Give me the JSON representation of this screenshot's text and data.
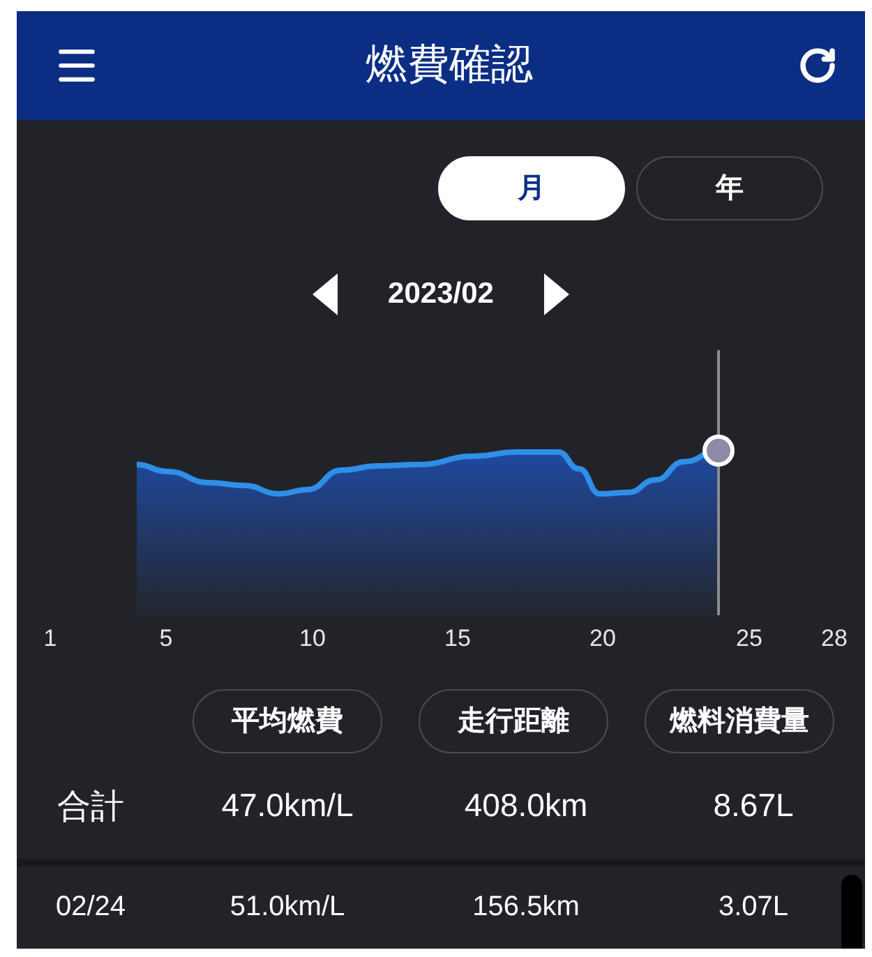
{
  "header": {
    "title": "燃費確認"
  },
  "period_tabs": [
    {
      "label": "月",
      "selected": true
    },
    {
      "label": "年",
      "selected": false
    }
  ],
  "month_nav": {
    "label": "2023/02"
  },
  "chart": {
    "x_labels": [
      "1",
      "5",
      "10",
      "15",
      "20",
      "25",
      "28"
    ]
  },
  "metric_buttons": [
    "平均燃費",
    "走行距離",
    "燃料消費量"
  ],
  "summary_row": {
    "label": "合計",
    "values": [
      "47.0km/L",
      "408.0km",
      "8.67L"
    ]
  },
  "rows": [
    {
      "date": "02/24",
      "values": [
        "51.0km/L",
        "156.5km",
        "3.07L"
      ]
    }
  ]
}
